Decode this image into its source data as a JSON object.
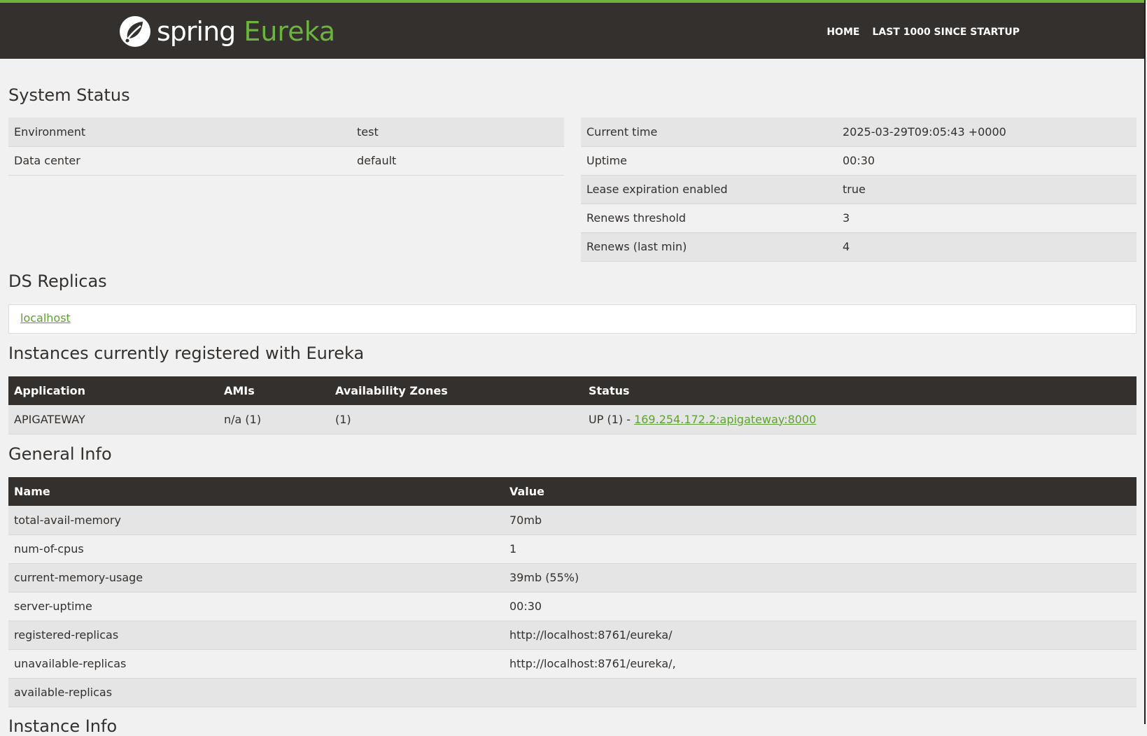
{
  "brand": {
    "spring": "spring",
    "eureka": "Eureka"
  },
  "nav": {
    "home": "HOME",
    "last1000": "LAST 1000 SINCE STARTUP"
  },
  "colors": {
    "accent": "#6db33f",
    "header_bg": "#34302d",
    "link": "#5fa134"
  },
  "system_status": {
    "title": "System Status",
    "left": [
      {
        "label": "Environment",
        "value": "test"
      },
      {
        "label": "Data center",
        "value": "default"
      }
    ],
    "right": [
      {
        "label": "Current time",
        "value": "2025-03-29T09:05:43 +0000"
      },
      {
        "label": "Uptime",
        "value": "00:30"
      },
      {
        "label": "Lease expiration enabled",
        "value": "true"
      },
      {
        "label": "Renews threshold",
        "value": "3"
      },
      {
        "label": "Renews (last min)",
        "value": "4"
      }
    ]
  },
  "ds_replicas": {
    "title": "DS Replicas",
    "link": "localhost"
  },
  "instances": {
    "title": "Instances currently registered with Eureka",
    "headers": [
      "Application",
      "AMIs",
      "Availability Zones",
      "Status"
    ],
    "rows": [
      {
        "application": "APIGATEWAY",
        "amis": "n/a (1)",
        "zones": "(1)",
        "status_prefix": "UP (1) - ",
        "status_link": "169.254.172.2:apigateway:8000"
      }
    ]
  },
  "general_info": {
    "title": "General Info",
    "headers": [
      "Name",
      "Value"
    ],
    "rows": [
      {
        "name": "total-avail-memory",
        "value": "70mb"
      },
      {
        "name": "num-of-cpus",
        "value": "1"
      },
      {
        "name": "current-memory-usage",
        "value": "39mb (55%)"
      },
      {
        "name": "server-uptime",
        "value": "00:30"
      },
      {
        "name": "registered-replicas",
        "value": "http://localhost:8761/eureka/"
      },
      {
        "name": "unavailable-replicas",
        "value": "http://localhost:8761/eureka/,"
      },
      {
        "name": "available-replicas",
        "value": ""
      }
    ]
  },
  "instance_info": {
    "title": "Instance Info"
  }
}
